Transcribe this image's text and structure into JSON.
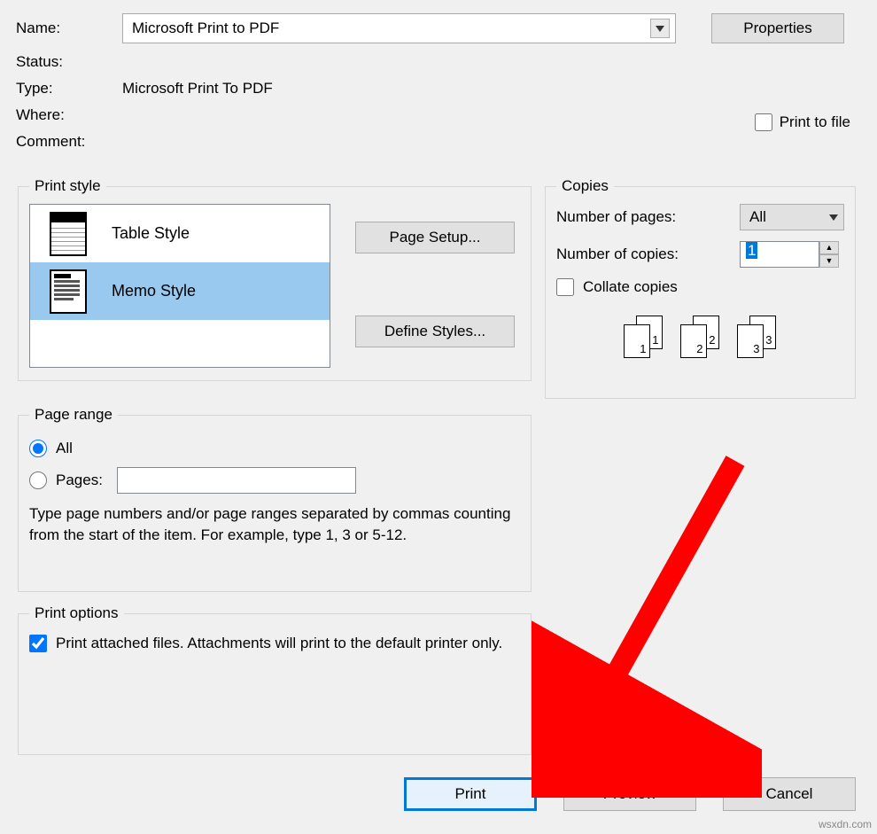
{
  "printer": {
    "name_label": "Name:",
    "name_value": "Microsoft Print to PDF",
    "properties_button": "Properties",
    "status_label": "Status:",
    "status_value": "",
    "type_label": "Type:",
    "type_value": "Microsoft Print To PDF",
    "where_label": "Where:",
    "where_value": "",
    "comment_label": "Comment:",
    "comment_value": "",
    "print_to_file_label": "Print to file"
  },
  "print_style": {
    "legend": "Print style",
    "items": [
      "Table Style",
      "Memo Style"
    ],
    "page_setup_button": "Page Setup...",
    "define_styles_button": "Define Styles..."
  },
  "copies": {
    "legend": "Copies",
    "num_pages_label": "Number of pages:",
    "num_pages_value": "All",
    "num_copies_label": "Number of copies:",
    "num_copies_value": "1",
    "collate_label": "Collate copies",
    "preview_pairs": [
      "1",
      "2",
      "3"
    ]
  },
  "page_range": {
    "legend": "Page range",
    "all_label": "All",
    "pages_label": "Pages:",
    "hint": "Type page numbers and/or page ranges separated by commas counting from the start of the item.  For example, type 1, 3 or 5-12."
  },
  "print_options": {
    "legend": "Print options",
    "attached_label": "Print attached files.  Attachments will print to the default printer only."
  },
  "buttons": {
    "print": "Print",
    "preview": "Preview",
    "cancel": "Cancel"
  },
  "watermark": "wsxdn.com"
}
